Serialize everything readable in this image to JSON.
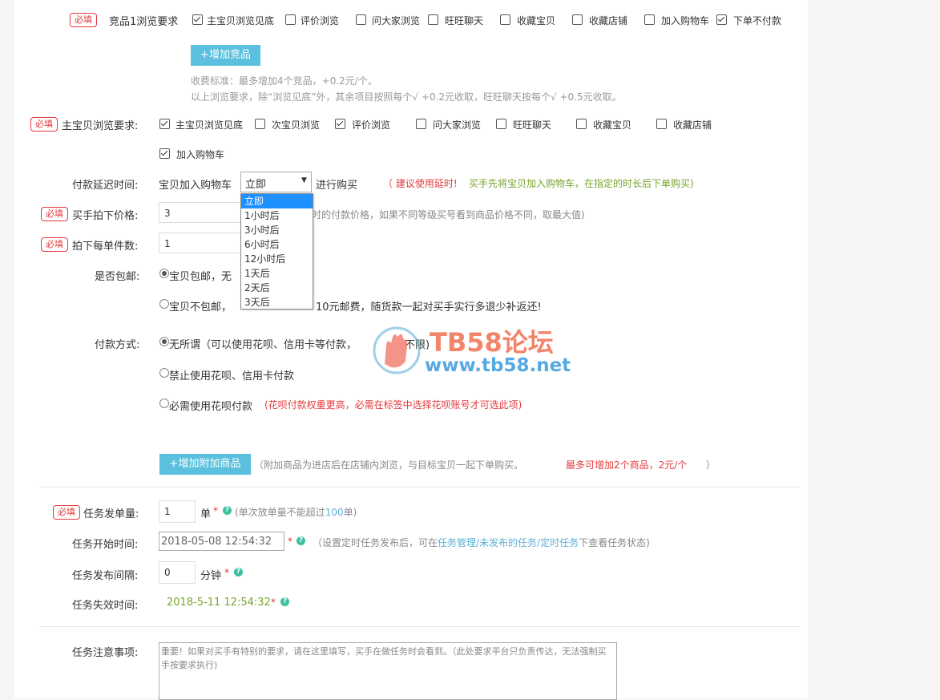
{
  "required_tag": "必填",
  "competitor": {
    "label": "竞品1浏览要求",
    "options": [
      {
        "label": "主宝贝浏览见底",
        "checked": true
      },
      {
        "label": "评价浏览",
        "checked": false
      },
      {
        "label": "问大家浏览",
        "checked": false
      },
      {
        "label": "旺旺聊天",
        "checked": false
      },
      {
        "label": "收藏宝贝",
        "checked": false
      },
      {
        "label": "收藏店铺",
        "checked": false
      },
      {
        "label": "加入购物车",
        "checked": false
      },
      {
        "label": "下单不付款",
        "checked": true
      }
    ],
    "add_button": "+增加竞品",
    "fee_note_1": "收费标准：最多增加4个竞品，+0.2元/个。",
    "fee_note_2": "以上浏览要求，除“浏览见底”外，其余项目按照每个√ +0.2元收取，旺旺聊天按每个√ +0.5元收取。"
  },
  "main_browse": {
    "label": "主宝贝浏览要求:",
    "options": [
      {
        "label": "主宝贝浏览见底",
        "checked": true
      },
      {
        "label": "次宝贝浏览",
        "checked": false
      },
      {
        "label": "评价浏览",
        "checked": true
      },
      {
        "label": "问大家浏览",
        "checked": false
      },
      {
        "label": "旺旺聊天",
        "checked": false
      },
      {
        "label": "收藏宝贝",
        "checked": false
      },
      {
        "label": "收藏店铺",
        "checked": false
      },
      {
        "label": "加入购物车",
        "checked": true
      }
    ]
  },
  "payment_delay": {
    "label": "付款延迟时间:",
    "prefix": "宝贝加入购物车",
    "selected": "立即",
    "suffix": "进行购买",
    "tip_red": "（ 建议使用延时! ",
    "tip_green": "买手先将宝贝加入购物车，在指定的时长后下单购买)",
    "options": [
      "立即",
      "1小时后",
      "3小时后",
      "6小时后",
      "12小时后",
      "1天后",
      "2天后",
      "3天后"
    ]
  },
  "price": {
    "label": "买手拍下价格:",
    "value": "3",
    "hint": "时的付款价格，如果不同等级买号看到商品价格不同，取最大值)"
  },
  "quantity": {
    "label": "拍下每单件数:",
    "value": "1"
  },
  "shipping": {
    "label": "是否包邮:",
    "opt1": "宝贝包邮，无",
    "opt2_a": "宝贝不包邮，",
    "opt2_b": "10元邮费，随货款一起对买手实行多退少补返还!"
  },
  "payment_method": {
    "label": "付款方式:",
    "opt1": "无所谓（可以使用花呗、信用卡等付款，",
    "opt1_tail": "不限)",
    "opt2": "禁止使用花呗、信用卡付款",
    "opt3": "必需使用花呗付款",
    "opt3_note": "(花呗付款权重更高，必需在标签中选择花呗账号才可选此项)"
  },
  "watermark": {
    "title": "TB58论坛",
    "url": "www.tb58.net"
  },
  "addon": {
    "button": "+增加附加商品",
    "note": "（附加商品为进店后在店铺内浏览，与目标宝贝一起下单购买。",
    "note_red": "最多可增加2个商品，2元/个",
    "note_end": "）"
  },
  "task_count": {
    "label": "任务发单量:",
    "value": "1",
    "unit": "单",
    "star": "*",
    "note_a": "(单次放单量不能超过",
    "note_num": "100",
    "note_b": "单)"
  },
  "task_start": {
    "label": "任务开始时间:",
    "value": "2018-05-08 12:54:32",
    "star": "*",
    "note_a": "（设置定时任务发布后，可在",
    "note_link": "任务管理/未发布的任务/定时任务",
    "note_b": "下查看任务状态)"
  },
  "task_interval": {
    "label": "任务发布间隔:",
    "value": "0",
    "unit": "分钟",
    "star": "*"
  },
  "task_expire": {
    "label": "任务失效时间:",
    "value": "2018-5-11 12:54:32",
    "star": "*"
  },
  "task_notes": {
    "label": "任务注意事项:",
    "placeholder": "重要！如果对买手有特别的要求，请在这里填写，买手在做任务时会看到。（此处要求平台只负责传达，无法强制买手按要求执行)"
  },
  "colors": {
    "accent": "#5bc0de",
    "required": "#e4393c",
    "green": "#7aa32c",
    "link": "#5bb0d8",
    "help": "#3dbfa0"
  }
}
